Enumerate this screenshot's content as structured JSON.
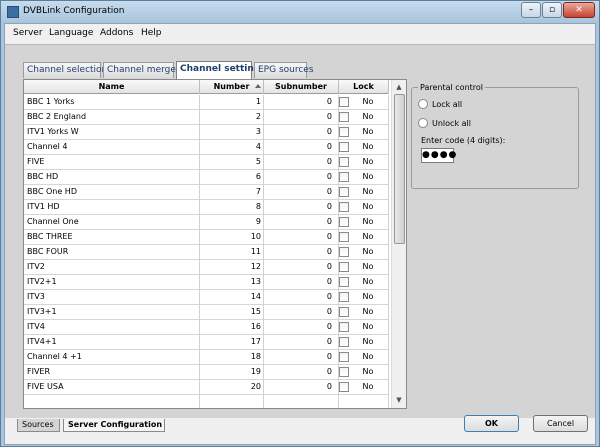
{
  "window": {
    "title": "DVBLink Configuration",
    "controls": {
      "minimize": "–",
      "maximize": "▫",
      "close": "✕"
    }
  },
  "menubar": {
    "items": [
      "Server",
      "Language",
      "Addons",
      "Help"
    ]
  },
  "tabs": [
    {
      "label": "Channel selection",
      "active": false
    },
    {
      "label": "Channel merge",
      "active": false
    },
    {
      "label": "Channel settings",
      "active": true
    },
    {
      "label": "EPG sources",
      "active": false
    }
  ],
  "grid": {
    "columns": {
      "name": "Name",
      "number": "Number",
      "subnumber": "Subnumber",
      "lock": "Lock"
    },
    "sort": {
      "column": "number",
      "direction": "ascending"
    },
    "rows": [
      {
        "name": "BBC 1 Yorks",
        "number": "1",
        "subnumber": "0",
        "lock": "No"
      },
      {
        "name": "BBC 2 England",
        "number": "2",
        "subnumber": "0",
        "lock": "No"
      },
      {
        "name": "ITV1 Yorks W",
        "number": "3",
        "subnumber": "0",
        "lock": "No"
      },
      {
        "name": "Channel 4",
        "number": "4",
        "subnumber": "0",
        "lock": "No"
      },
      {
        "name": "FIVE",
        "number": "5",
        "subnumber": "0",
        "lock": "No"
      },
      {
        "name": "BBC HD",
        "number": "6",
        "subnumber": "0",
        "lock": "No"
      },
      {
        "name": "BBC One HD",
        "number": "7",
        "subnumber": "0",
        "lock": "No"
      },
      {
        "name": "ITV1 HD",
        "number": "8",
        "subnumber": "0",
        "lock": "No"
      },
      {
        "name": "Channel One",
        "number": "9",
        "subnumber": "0",
        "lock": "No"
      },
      {
        "name": "BBC THREE",
        "number": "10",
        "subnumber": "0",
        "lock": "No"
      },
      {
        "name": "BBC FOUR",
        "number": "11",
        "subnumber": "0",
        "lock": "No"
      },
      {
        "name": "ITV2",
        "number": "12",
        "subnumber": "0",
        "lock": "No"
      },
      {
        "name": "ITV2+1",
        "number": "13",
        "subnumber": "0",
        "lock": "No"
      },
      {
        "name": "ITV3",
        "number": "14",
        "subnumber": "0",
        "lock": "No"
      },
      {
        "name": "ITV3+1",
        "number": "15",
        "subnumber": "0",
        "lock": "No"
      },
      {
        "name": "ITV4",
        "number": "16",
        "subnumber": "0",
        "lock": "No"
      },
      {
        "name": "ITV4+1",
        "number": "17",
        "subnumber": "0",
        "lock": "No"
      },
      {
        "name": "Channel 4 +1",
        "number": "18",
        "subnumber": "0",
        "lock": "No"
      },
      {
        "name": "FIVER",
        "number": "19",
        "subnumber": "0",
        "lock": "No"
      },
      {
        "name": "FIVE USA",
        "number": "20",
        "subnumber": "0",
        "lock": "No"
      }
    ]
  },
  "parental_control": {
    "title": "Parental control",
    "lock_all": "Lock all",
    "unlock_all": "Unlock all",
    "code_label": "Enter code (4 digits):",
    "code_value": "●●●●"
  },
  "bottom_tabs": [
    {
      "label": "Sources",
      "active": false
    },
    {
      "label": "Server Configuration",
      "active": true
    }
  ],
  "buttons": {
    "ok": "OK",
    "cancel": "Cancel"
  }
}
